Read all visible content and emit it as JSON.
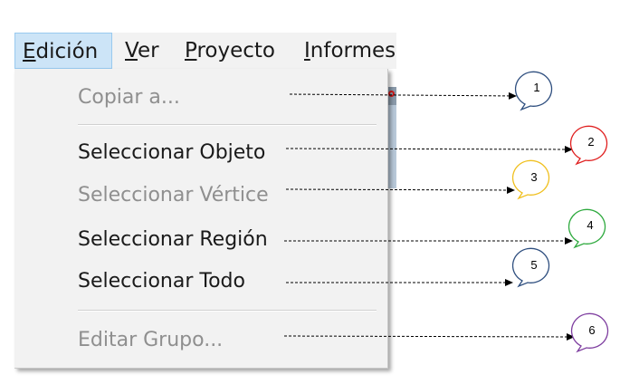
{
  "menubar": {
    "items": [
      {
        "label_ul": "E",
        "label_rest": "dición"
      },
      {
        "label_ul": "V",
        "label_rest": "er"
      },
      {
        "label_ul": "P",
        "label_rest": "royecto"
      },
      {
        "label_ul": "I",
        "label_rest": "nformes"
      }
    ]
  },
  "menu": {
    "items": [
      {
        "label": "Copiar a...",
        "enabled": false
      },
      {
        "label": "Seleccionar Objeto",
        "enabled": true
      },
      {
        "label": "Seleccionar Vértice",
        "enabled": false
      },
      {
        "label": "Seleccionar Región",
        "enabled": true
      },
      {
        "label": "Seleccionar Todo",
        "enabled": true
      },
      {
        "label": "Editar Grupo...",
        "enabled": false
      }
    ]
  },
  "callouts": [
    {
      "number": "1",
      "color": "#2f4f7f"
    },
    {
      "number": "2",
      "color": "#e02020"
    },
    {
      "number": "3",
      "color": "#f0c020"
    },
    {
      "number": "4",
      "color": "#2faa3f"
    },
    {
      "number": "5",
      "color": "#2f4f7f"
    },
    {
      "number": "6",
      "color": "#7f3fa0"
    }
  ]
}
